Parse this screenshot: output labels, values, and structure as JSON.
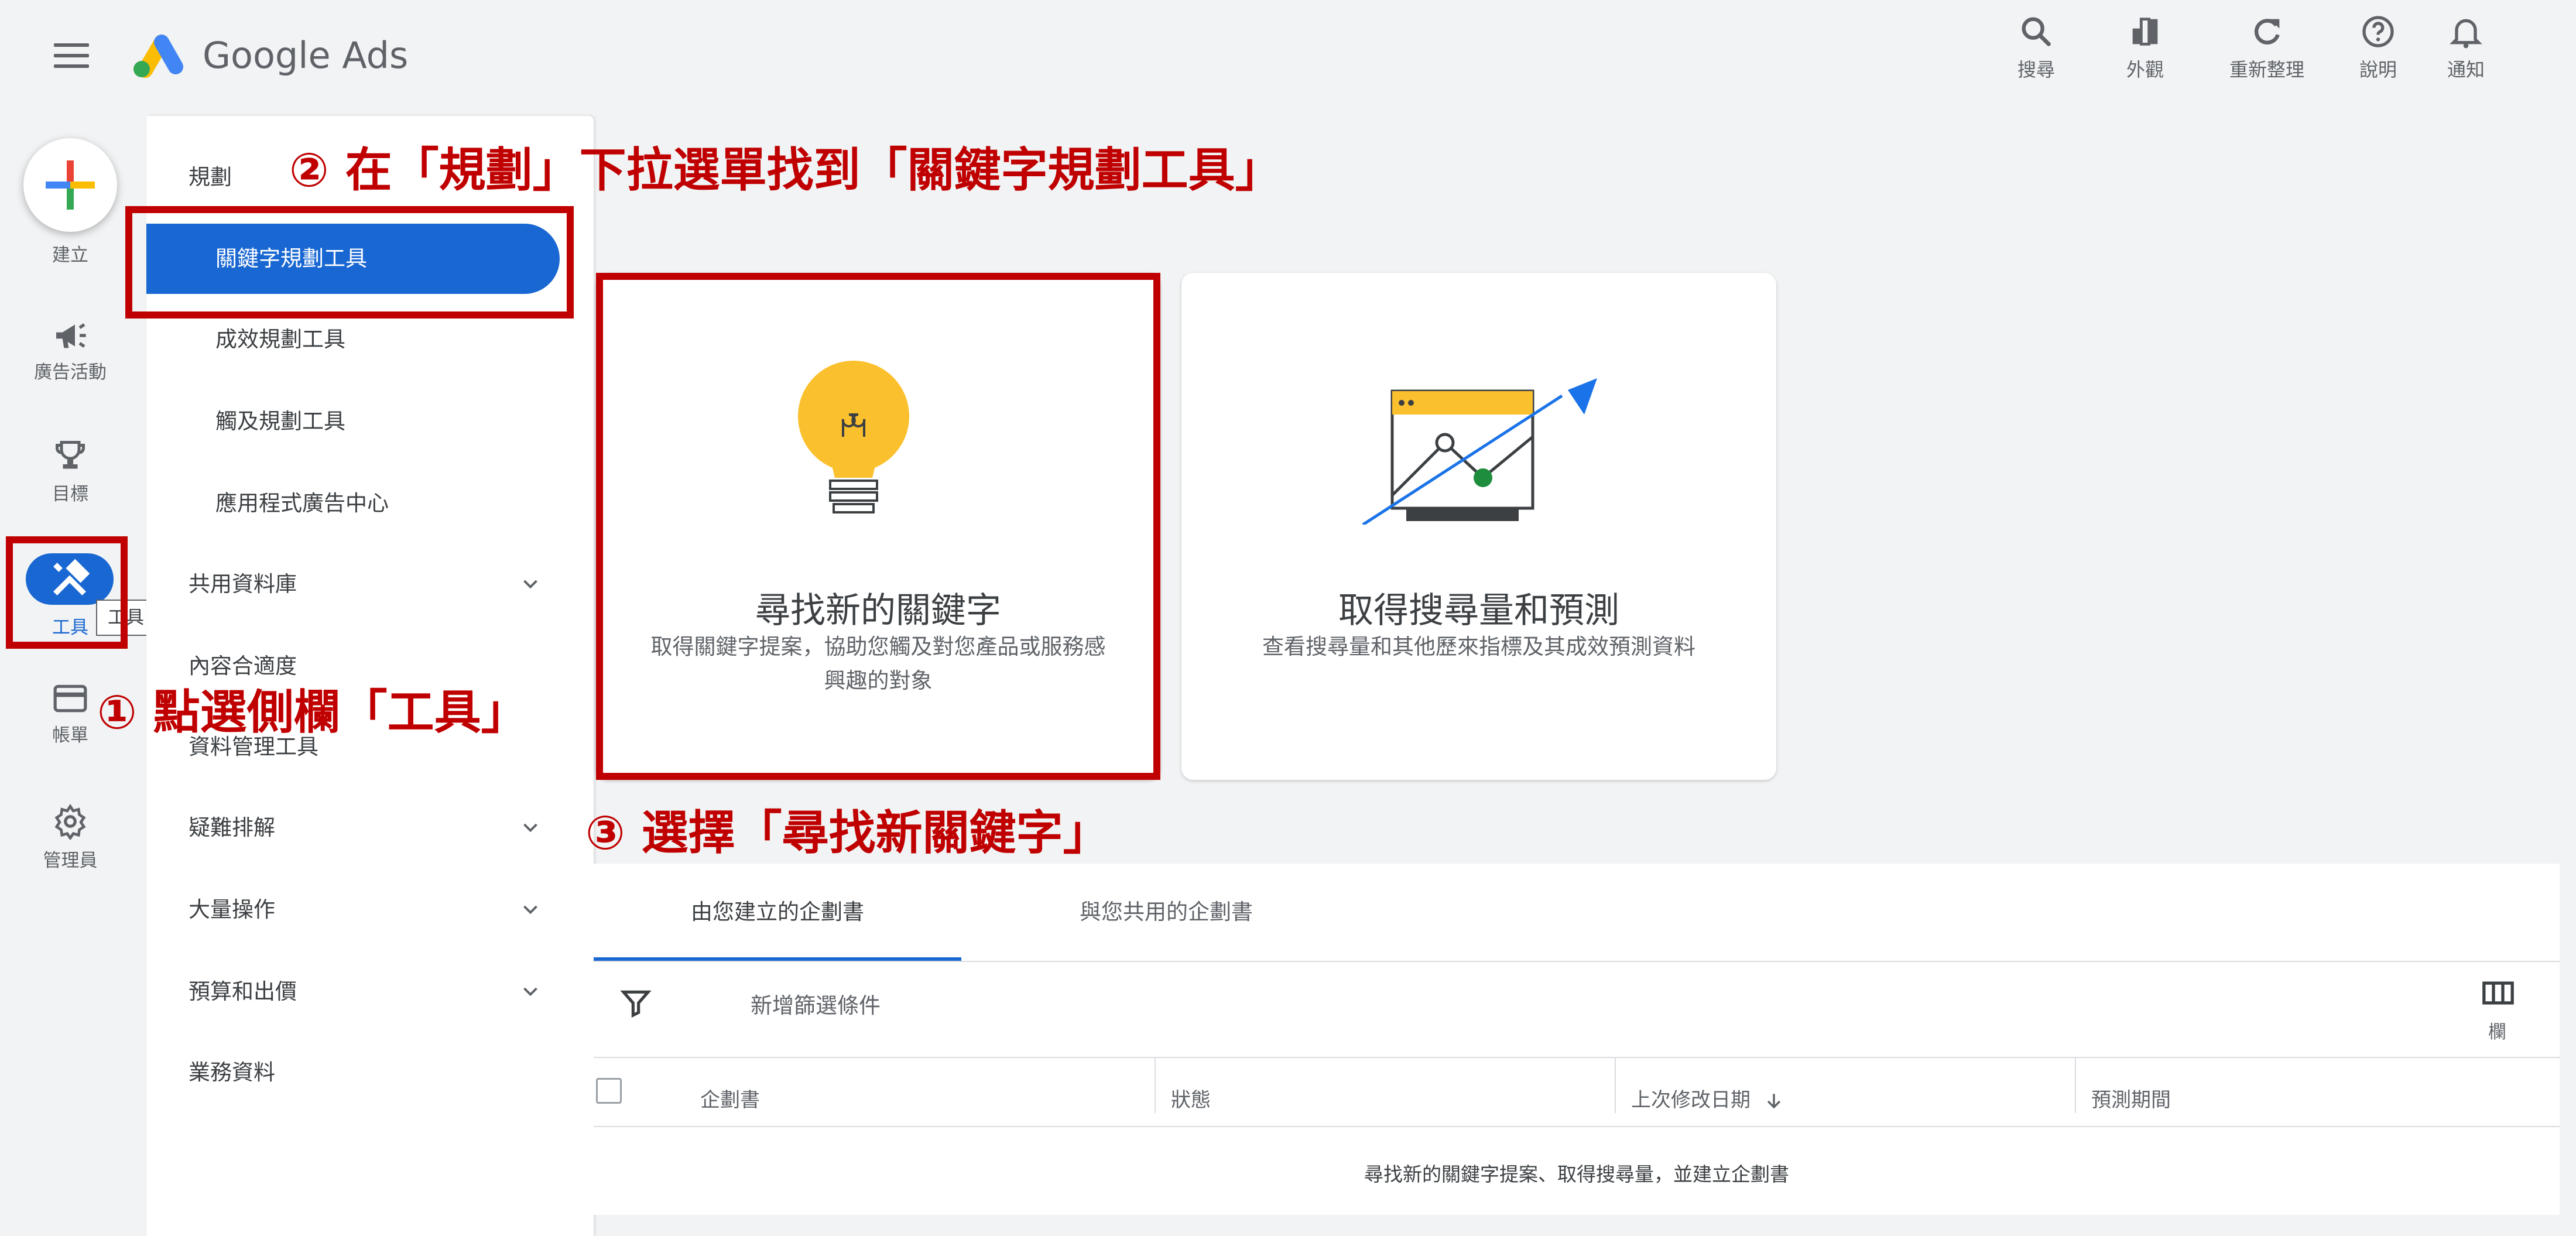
{
  "app": {
    "name": "Google Ads"
  },
  "topbar": {
    "search": "搜尋",
    "appearance": "外觀",
    "refresh": "重新整理",
    "help": "說明",
    "notifications": "通知"
  },
  "rail": {
    "create": "建立",
    "campaigns": "廣告活動",
    "goals": "目標",
    "tools": "工具",
    "billing": "帳單",
    "admin": "管理員",
    "tools_tooltip": "工具"
  },
  "drawer": {
    "section_planning": "規劃",
    "keyword_planner": "關鍵字規劃工具",
    "performance_planner": "成效規劃工具",
    "reach_planner": "觸及規劃工具",
    "app_ads_hub": "應用程式廣告中心",
    "shared_library": "共用資料庫",
    "content_suitability": "內容合適度",
    "data_manager": "資料管理工具",
    "troubleshooting": "疑難排解",
    "bulk_actions": "大量操作",
    "budgets_bidding": "預算和出價",
    "business_data": "業務資料"
  },
  "cards": {
    "discover": {
      "title": "尋找新的關鍵字",
      "desc_line1": "取得關鍵字提案，協助您觸及對您產品或服務感",
      "desc_line2": "興趣的對象"
    },
    "forecast": {
      "title": "取得搜尋量和預測",
      "desc": "查看搜尋量和其他歷來指標及其成效預測資料"
    }
  },
  "annotations": {
    "step1": "① 點選側欄「工具」",
    "step2": "② 在「規劃」下拉選單找到「關鍵字規劃工具」",
    "step3": "③ 選擇「尋找新關鍵字」"
  },
  "plans": {
    "tabs": [
      "由您建立的企劃書",
      "與您共用的企劃書"
    ],
    "add_filter": "新增篩選條件",
    "columns_label": "欄",
    "headers": {
      "plan": "企劃書",
      "status": "狀態",
      "last_modified": "上次修改日期",
      "forecast_period": "預測期間"
    },
    "empty_message": "尋找新的關鍵字提案、取得搜尋量，並建立企劃書"
  },
  "colors": {
    "accent_blue": "#1967d2",
    "annotation_red": "#c00000",
    "bulb_yellow": "#fbc02d",
    "chart_green": "#1e8e3e"
  }
}
